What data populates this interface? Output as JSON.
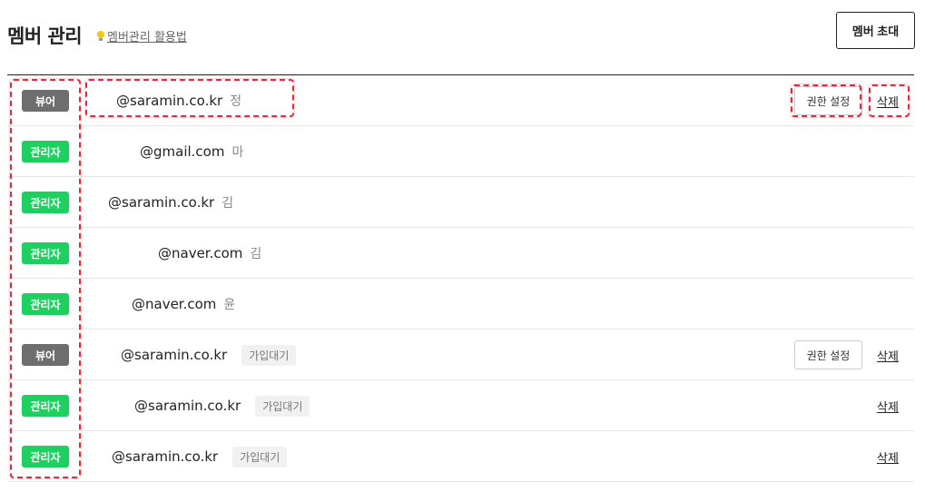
{
  "header": {
    "title": "멤버 관리",
    "help_link": "멤버관리 활용법",
    "invite_button": "멤버 초대"
  },
  "members": [
    {
      "role": "뷰어",
      "email": "@saramin.co.kr",
      "name": "정",
      "pending": "",
      "permission_button": "권한 설정",
      "delete": "삭제"
    },
    {
      "role": "관리자",
      "email": "@gmail.com",
      "name": "마",
      "pending": "",
      "permission_button": "",
      "delete": ""
    },
    {
      "role": "관리자",
      "email": "@saramin.co.kr",
      "name": "김",
      "pending": "",
      "permission_button": "",
      "delete": ""
    },
    {
      "role": "관리자",
      "email": "@naver.com",
      "name": "김",
      "pending": "",
      "permission_button": "",
      "delete": ""
    },
    {
      "role": "관리자",
      "email": "@naver.com",
      "name": "윤",
      "pending": "",
      "permission_button": "",
      "delete": ""
    },
    {
      "role": "뷰어",
      "email": "@saramin.co.kr",
      "name": "",
      "pending": "가입대기",
      "permission_button": "권한 설정",
      "delete": "삭제"
    },
    {
      "role": "관리자",
      "email": "@saramin.co.kr",
      "name": "",
      "pending": "가입대기",
      "permission_button": "",
      "delete": "삭제"
    },
    {
      "role": "관리자",
      "email": "@saramin.co.kr",
      "name": "",
      "pending": "가입대기",
      "permission_button": "",
      "delete": "삭제"
    }
  ],
  "colors": {
    "viewer_badge": "#6e6e6e",
    "admin_badge": "#1ed05f",
    "highlight": "#e8283a"
  }
}
